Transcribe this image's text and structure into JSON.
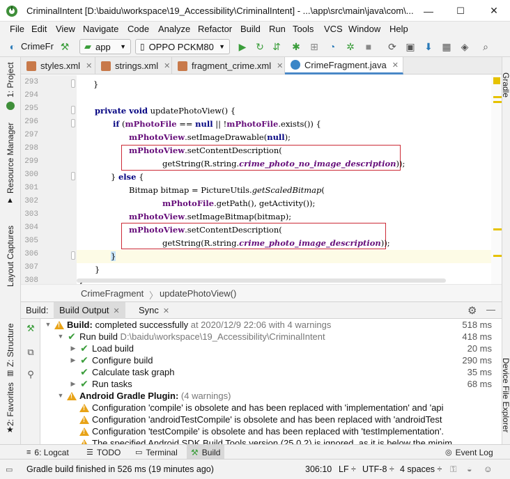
{
  "window": {
    "title": "CriminalIntent [D:\\baidu\\workspace\\19_Accessibility\\CriminalIntent] - ...\\app\\src\\main\\java\\com\\...",
    "minimize": "—",
    "maximize": "☐",
    "close": "✕"
  },
  "menu": [
    "File",
    "Edit",
    "View",
    "Navigate",
    "Code",
    "Analyze",
    "Refactor",
    "Build",
    "Run",
    "Tools",
    "VCS",
    "Window",
    "Help"
  ],
  "toolbar": {
    "project": "CrimeFr",
    "run_config": "app",
    "device": "OPPO PCKM80"
  },
  "left_panels": [
    "1: Project",
    "Resource Manager",
    "Layout Captures",
    "Z: Structure",
    "2: Favorites"
  ],
  "right_panels": [
    "Gradle",
    "Device File Explorer"
  ],
  "editor_tabs": [
    {
      "label": "styles.xml",
      "active": false
    },
    {
      "label": "strings.xml",
      "active": false
    },
    {
      "label": "fragment_crime.xml",
      "active": false
    },
    {
      "label": "CrimeFragment.java",
      "active": true
    }
  ],
  "code": {
    "line_numbers": [
      "293",
      "294",
      "295",
      "296",
      "297",
      "298",
      "299",
      "300",
      "301",
      "302",
      "303",
      "304",
      "305",
      "306",
      "307",
      "308"
    ],
    "lines": {
      "l293": "}",
      "l295_kw": "private void",
      "l295_rest": " updatePhotoView() {",
      "l296_if": "if",
      "l296_a": " (",
      "l296_f1": "mPhotoFile",
      "l296_b": " == ",
      "l296_null": "null",
      "l296_c": " || !",
      "l296_f2": "mPhotoFile",
      "l296_d": ".exists()) {",
      "l297_f": "mPhotoView",
      "l297_a": ".setImageDrawable(",
      "l297_null": "null",
      "l297_b": ");",
      "l298_f": "mPhotoView",
      "l298_a": ".setContentDescription(",
      "l299_a": "getString(R.string.",
      "l299_res": "crime_photo_no_image_description",
      "l299_b": "));",
      "l300_a": "} ",
      "l300_else": "else",
      "l300_b": " {",
      "l301_a": "Bitmap bitmap = PictureUtils.",
      "l301_m": "getScaledBitmap",
      "l301_b": "(",
      "l302_f": "mPhotoFile",
      "l302_a": ".getPath(), getActivity());",
      "l303_f": "mPhotoView",
      "l303_a": ".setImageBitmap(bitmap);",
      "l304_f": "mPhotoView",
      "l304_a": ".setContentDescription(",
      "l305_a": "getString(R.string.",
      "l305_res": "crime_photo_image_description",
      "l305_b": "));",
      "l306": "}",
      "l307": "}",
      "l308": "}"
    }
  },
  "breadcrumb": [
    "CrimeFragment",
    "updatePhotoView()"
  ],
  "build_panel": {
    "label": "Build:",
    "tabs": [
      "Build Output",
      "Sync"
    ],
    "rows": [
      {
        "level": 0,
        "icon": "warning-icon",
        "expanded": true,
        "bold": "Build:",
        "text": " completed successfully",
        "gray": " at 2020/12/9 22:06  with 4 warnings",
        "duration": "518 ms"
      },
      {
        "level": 1,
        "icon": "check-icon",
        "expanded": true,
        "bold": "",
        "text": "Run build",
        "gray": " D:\\baidu\\workspace\\19_Accessibility\\CriminalIntent",
        "duration": "418 ms"
      },
      {
        "level": 2,
        "icon": "check-icon",
        "expanded": false,
        "bold": "",
        "text": "Load build",
        "gray": "",
        "duration": "20 ms"
      },
      {
        "level": 2,
        "icon": "check-icon",
        "expanded": false,
        "bold": "",
        "text": "Configure build",
        "gray": "",
        "duration": "290 ms"
      },
      {
        "level": 2,
        "icon": "check-icon",
        "expanded": null,
        "bold": "",
        "text": "Calculate task graph",
        "gray": "",
        "duration": "35 ms"
      },
      {
        "level": 2,
        "icon": "check-icon",
        "expanded": false,
        "bold": "",
        "text": "Run tasks",
        "gray": "",
        "duration": "68 ms"
      },
      {
        "level": 1,
        "icon": "warning-icon",
        "expanded": true,
        "bold": "Android Gradle Plugin:",
        "text": "",
        "gray": "  (4 warnings)",
        "duration": ""
      },
      {
        "level": 2,
        "icon": "warning-icon",
        "expanded": null,
        "bold": "",
        "text": "Configuration 'compile' is obsolete and has been replaced with 'implementation' and 'api",
        "gray": "",
        "duration": ""
      },
      {
        "level": 2,
        "icon": "warning-icon",
        "expanded": null,
        "bold": "",
        "text": "Configuration 'androidTestCompile' is obsolete and has been replaced with 'androidTest",
        "gray": "",
        "duration": ""
      },
      {
        "level": 2,
        "icon": "warning-icon",
        "expanded": null,
        "bold": "",
        "text": "Configuration 'testCompile' is obsolete and has been replaced with 'testImplementation'.",
        "gray": "",
        "duration": ""
      },
      {
        "level": 2,
        "icon": "warning-icon",
        "expanded": null,
        "bold": "",
        "text": "The specified Android SDK Build Tools version (25.0.2) is ignored, as it is below the minim",
        "gray": "",
        "duration": ""
      }
    ]
  },
  "bottom_tabs": [
    "6: Logcat",
    "TODO",
    "Terminal",
    "Build",
    "Event Log"
  ],
  "status": {
    "message": "Gradle build finished in 526 ms (19 minutes ago)",
    "position": "306:10",
    "line_sep": "LF ÷",
    "encoding": "UTF-8 ÷",
    "indent": "4 spaces ÷"
  },
  "colors": {
    "keyword": "#000080",
    "field": "#660e7a",
    "highlight_box": "#cc2a36",
    "success": "#3a9d3a",
    "warning": "#e8a317",
    "tab_accent": "#4a88c7"
  }
}
